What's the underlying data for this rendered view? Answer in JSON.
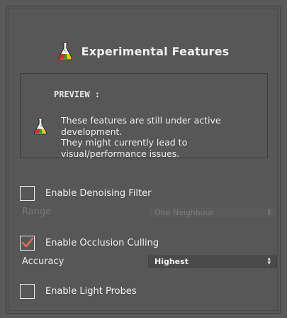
{
  "header": {
    "title": "Experimental Features",
    "icon": "flask-icon"
  },
  "preview": {
    "title": "PREVIEW :",
    "lines": [
      "These features are still under active",
      "development.",
      "They might currently lead to",
      "visual/performance issues."
    ]
  },
  "denoising": {
    "label": "Enable Denoising Filter",
    "checked": false,
    "range_label": "Range",
    "range_value": "One Neighbour"
  },
  "occlusion": {
    "label": "Enable Occlusion Culling",
    "checked": true,
    "accuracy_label": "Accuracy",
    "accuracy_value": "Highest"
  },
  "light_probes": {
    "label": "Enable Light Probes",
    "checked": false
  },
  "colors": {
    "checkmark": "#e06b4c",
    "panel_bg": "#575757",
    "text": "#e8e8e8",
    "disabled_text": "#777777"
  }
}
